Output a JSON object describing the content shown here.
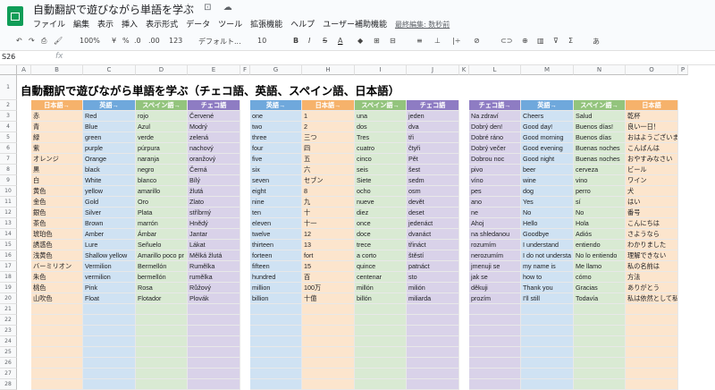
{
  "app": {
    "title": "自動翻訳で遊びながら単語を学ぶ",
    "title_icons": "☆ ⊡ ☁",
    "menu": [
      "ファイル",
      "編集",
      "表示",
      "挿入",
      "表示形式",
      "データ",
      "ツール",
      "拡張機能",
      "ヘルプ",
      "ユーザー補助機能"
    ],
    "last_edit": "最終編集: 数秒前"
  },
  "toolbar": {
    "undo": "↶",
    "redo": "↷",
    "print": "⎙",
    "paint": "🖌",
    "zoom": "100%",
    "currency": "¥",
    "percent": "%",
    "dec_less": ".0",
    "dec_more": ".00",
    "more_formats": "123",
    "font": "デフォルト...",
    "font_size": "10",
    "bold": "B",
    "italic": "I",
    "strike": "S",
    "text_color": "A",
    "fill": "◆",
    "borders": "⊞",
    "merge": "⊟",
    "halign": "≡",
    "valign": "⊥",
    "wrap": "|÷",
    "rotate": "⊘",
    "link": "⊂⊃",
    "comment": "⊕",
    "chart": "▥",
    "filter": "⊽",
    "functions": "Σ",
    "input_tools": "あ"
  },
  "formula_bar": {
    "cell_ref": "S26",
    "fx": "fx",
    "content": ""
  },
  "colors": {
    "jp": "#f6b26b",
    "en": "#6fa8dc",
    "es": "#93c47d",
    "cs": "#8e7cc3",
    "jp_light": "#fce5cd",
    "en_light": "#cfe2f3",
    "es_light": "#d9ead3",
    "cs_light": "#d9d2e9"
  },
  "columns": [
    "A",
    "B",
    "C",
    "D",
    "E",
    "F",
    "G",
    "H",
    "I",
    "J",
    "K",
    "L",
    "M",
    "N",
    "O",
    "P"
  ],
  "rows": [
    "1",
    "2",
    "3",
    "4",
    "5",
    "6",
    "7",
    "8",
    "9",
    "10",
    "11",
    "12",
    "13",
    "14",
    "15",
    "16",
    "17",
    "18",
    "19",
    "20",
    "21",
    "22",
    "23",
    "24",
    "25",
    "26",
    "27",
    "28"
  ],
  "sheet_title": "自動翻訳で遊びながら単語を学ぶ（チェコ語、英語、スペイン語、日本語）",
  "table1": {
    "headers": [
      "日本語→",
      "英語→",
      "スペイン語→",
      "チェコ語"
    ],
    "rows": [
      [
        "赤",
        "Red",
        "rojo",
        "Červené"
      ],
      [
        "青",
        "Blue",
        "Azul",
        "Modrý"
      ],
      [
        "緑",
        "green",
        "verde",
        "zelená"
      ],
      [
        "紫",
        "purple",
        "púrpura",
        "nachový"
      ],
      [
        "オレンジ",
        "Orange",
        "naranja",
        "oranžový"
      ],
      [
        "黒",
        "black",
        "negro",
        "Černá"
      ],
      [
        "白",
        "White",
        "blanco",
        "Bílý"
      ],
      [
        "黄色",
        "yellow",
        "amarillo",
        "žlutá"
      ],
      [
        "金色",
        "Gold",
        "Oro",
        "Zlato"
      ],
      [
        "銀色",
        "Silver",
        "Plata",
        "stříbrný"
      ],
      [
        "茶色",
        "Brown",
        "marrón",
        "Hnědý"
      ],
      [
        "琥珀色",
        "Amber",
        "Ámbar",
        "Jantar"
      ],
      [
        "誘惑色",
        "Lure",
        "Señuelo",
        "Lákat"
      ],
      [
        "浅黄色",
        "Shallow yellow",
        "Amarillo poco pr",
        "Mělká žlutá"
      ],
      [
        "バーミリオン",
        "Vermilion",
        "Bermellón",
        "Rumělka"
      ],
      [
        "朱色",
        "vermilion",
        "bermellón",
        "rumělka"
      ],
      [
        "桃色",
        "Pink",
        "Rosa",
        "Růžový"
      ],
      [
        "山吹色",
        "Float",
        "Flotador",
        "Plovák"
      ]
    ]
  },
  "table2": {
    "headers": [
      "英語→",
      "日本語→",
      "スペイン語→",
      "チェコ語"
    ],
    "rows": [
      [
        "one",
        "1",
        "una",
        "jeden"
      ],
      [
        "two",
        "2",
        "dos",
        "dva"
      ],
      [
        "three",
        "三つ",
        "Tres",
        "tři"
      ],
      [
        "four",
        "四",
        "cuatro",
        "čtyři"
      ],
      [
        "five",
        "五",
        "cinco",
        "Pět"
      ],
      [
        "six",
        "六",
        "seis",
        "šest"
      ],
      [
        "seven",
        "セブン",
        "Siete",
        "sedm"
      ],
      [
        "eight",
        "8",
        "ocho",
        "osm"
      ],
      [
        "nine",
        "九",
        "nueve",
        "devět"
      ],
      [
        "ten",
        "十",
        "diez",
        "deset"
      ],
      [
        "eleven",
        "十一",
        "once",
        "jedenáct"
      ],
      [
        "twelve",
        "12",
        "doce",
        "dvanáct"
      ],
      [
        "thirteen",
        "13",
        "trece",
        "třináct"
      ],
      [
        "forteen",
        "fort",
        "a corto",
        "štěstí"
      ],
      [
        "fifteen",
        "15",
        "quince",
        "patnáct"
      ],
      [
        "hundred",
        "百",
        "centenar",
        "sto"
      ],
      [
        "million",
        "100万",
        "millón",
        "milión"
      ],
      [
        "billion",
        "十億",
        "billón",
        "miliarda"
      ]
    ]
  },
  "table3": {
    "headers": [
      "チェコ語→",
      "英語→",
      "スペイン語→",
      "日本語"
    ],
    "rows": [
      [
        "Na zdraví",
        "Cheers",
        "Salud",
        "乾杯"
      ],
      [
        "Dobrý den!",
        "Good day!",
        "Buenos días!",
        "良い一日！"
      ],
      [
        "Dobré ráno",
        "Good morning",
        "Buenos días",
        "おはようございます"
      ],
      [
        "Dobrý večer",
        "Good evening",
        "Buenas noches",
        "こんばんは"
      ],
      [
        "Dobrou noc",
        "Good night",
        "Buenas noches",
        "おやすみなさい"
      ],
      [
        "pivo",
        "beer",
        "cerveza",
        "ビール"
      ],
      [
        "víno",
        "wine",
        "vino",
        "ワイン"
      ],
      [
        "pes",
        "dog",
        "perro",
        "犬"
      ],
      [
        "ano",
        "Yes",
        "sí",
        "はい"
      ],
      [
        "ne",
        "No",
        "No",
        "番号"
      ],
      [
        "Ahoj",
        "Hello",
        "Hola",
        "こんにちは"
      ],
      [
        "na shledanou",
        "Goodbye",
        "Adiós",
        "さようなら"
      ],
      [
        "rozumím",
        "I understand",
        "entiendo",
        "わかりました"
      ],
      [
        "nerozumím",
        "I do not understa",
        "No lo entiendo",
        "理解できない"
      ],
      [
        "jmenuji se",
        "my name is",
        "Me llamo",
        "私の名前は"
      ],
      [
        "jak se",
        "how to",
        "cómo",
        "方法"
      ],
      [
        "děkuji",
        "Thank you",
        "Gracias",
        "ありがとう"
      ],
      [
        "prozím",
        "I'll still",
        "Todavía",
        "私は依然として私は"
      ]
    ]
  }
}
